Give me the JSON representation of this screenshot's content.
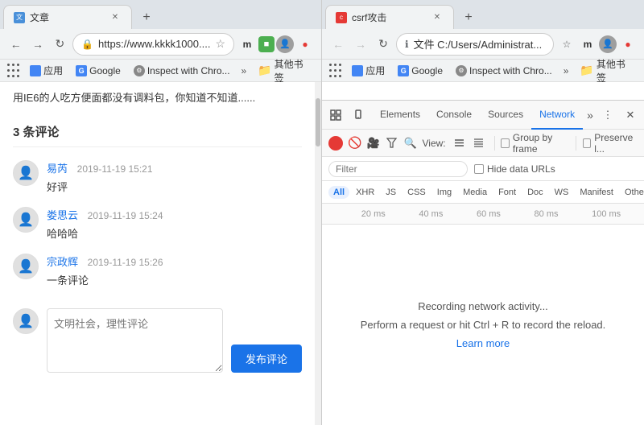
{
  "left_browser": {
    "tab_title": "文章",
    "tab_favicon": "文",
    "new_tab_label": "+",
    "back_disabled": false,
    "forward_disabled": false,
    "address": "https://www.kkkk1000....",
    "bookmarks": [
      {
        "label": "应用",
        "icon": "grid"
      },
      {
        "label": "Google",
        "icon": "G"
      },
      {
        "label": "Inspect with Chro...",
        "icon": "inspect"
      }
    ],
    "more_label": "»",
    "other_bookmarks_label": "其他书签",
    "article_intro": "用IE6的人吃方便面都没有调料包，你知道不知道......",
    "comments_count": "3 条评论",
    "comments": [
      {
        "author": "易芮",
        "time": "2019-11-19 15:21",
        "text": "好评"
      },
      {
        "author": "娄思云",
        "time": "2019-11-19 15:24",
        "text": "哈哈哈"
      },
      {
        "author": "宗政辉",
        "time": "2019-11-19 15:26",
        "text": "一条评论"
      }
    ],
    "textarea_placeholder": "文明社会，理性评论",
    "submit_label": "发布评论"
  },
  "right_browser": {
    "tab_title": "csrf攻击",
    "tab_favicon": "c",
    "new_tab_label": "+",
    "address": "文件  C:/Users/Administrat...",
    "bookmarks": [
      {
        "label": "应用",
        "icon": "grid"
      },
      {
        "label": "Google",
        "icon": "G"
      },
      {
        "label": "Inspect with Chro...",
        "icon": "inspect"
      }
    ],
    "more_label": "»",
    "other_bookmarks_label": "其他书签"
  },
  "devtools": {
    "tabs": [
      {
        "label": "Elements",
        "active": false
      },
      {
        "label": "Console",
        "active": false
      },
      {
        "label": "Sources",
        "active": false
      },
      {
        "label": "Network",
        "active": true
      },
      {
        "label": "»",
        "active": false
      }
    ],
    "filter_placeholder": "Filter",
    "hide_data_urls": "Hide data URLs",
    "type_filters": [
      "All",
      "XHR",
      "JS",
      "CSS",
      "Img",
      "Media",
      "Font",
      "Doc",
      "WS",
      "Manifest",
      "Other"
    ],
    "active_type": "All",
    "view_label": "View:",
    "group_by_frame": "Group by frame",
    "preserve_log": "Preserve l...",
    "timeline_labels": [
      "20 ms",
      "40 ms",
      "60 ms",
      "80 ms",
      "100 ms"
    ],
    "empty_line1": "Recording network activity...",
    "empty_line2": "Perform a request or hit Ctrl + R to record the reload.",
    "learn_more": "Learn more"
  }
}
